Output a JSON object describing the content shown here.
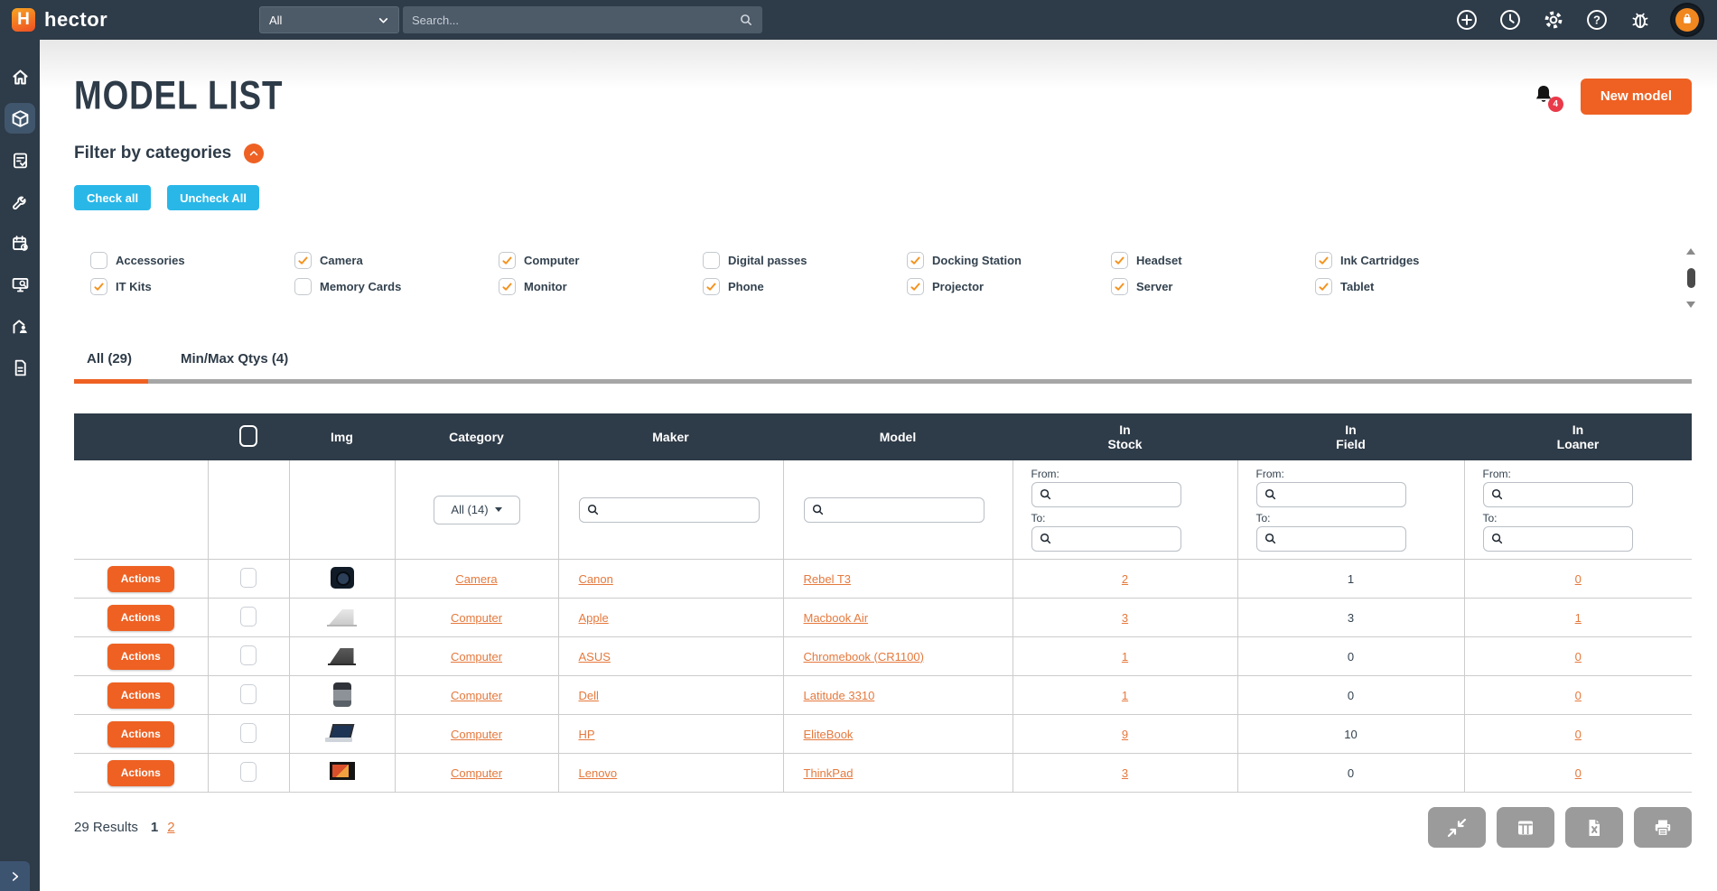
{
  "colors": {
    "dark_slate": "#2e3b48",
    "accent_orange": "#ee6123",
    "link_orange": "#e5793d",
    "check_orange": "#f5921e",
    "cyan": "#29b7e8",
    "badge_red": "#e93a4a",
    "gray_button": "#9b9b9b"
  },
  "topbar": {
    "brand": "hector",
    "scope_select_value": "All",
    "search_placeholder": "Search...",
    "icons": [
      "plus-circle-icon",
      "clock-icon",
      "gear-icon",
      "help-icon",
      "bug-icon",
      "avatar"
    ]
  },
  "sidebar": {
    "items": [
      "home-icon",
      "package-icon",
      "clipboard-check-icon",
      "wrench-icon",
      "calendar-clock-icon",
      "monitor-search-icon",
      "user-building-icon",
      "document-icon"
    ],
    "active_item": "package-icon"
  },
  "page": {
    "title": "MODEL LIST",
    "notification_count": "4",
    "new_model_label": "New model"
  },
  "filters": {
    "heading": "Filter by categories",
    "check_all_label": "Check all",
    "uncheck_all_label": "Uncheck All",
    "categories": [
      {
        "label": "Accessories",
        "checked": false
      },
      {
        "label": "Camera",
        "checked": true
      },
      {
        "label": "Computer",
        "checked": true
      },
      {
        "label": "Digital passes",
        "checked": false
      },
      {
        "label": "Docking Station",
        "checked": true
      },
      {
        "label": "Headset",
        "checked": true
      },
      {
        "label": "Ink Cartridges",
        "checked": true
      },
      {
        "label": "IT Kits",
        "checked": true
      },
      {
        "label": "Memory Cards",
        "checked": false
      },
      {
        "label": "Monitor",
        "checked": true
      },
      {
        "label": "Phone",
        "checked": true
      },
      {
        "label": "Projector",
        "checked": true
      },
      {
        "label": "Server",
        "checked": true
      },
      {
        "label": "Tablet",
        "checked": true
      }
    ]
  },
  "tabs": [
    {
      "label": "All (29)",
      "active": true
    },
    {
      "label": "Min/Max Qtys (4)",
      "active": false
    }
  ],
  "table": {
    "headers": {
      "img": "Img",
      "category": "Category",
      "maker": "Maker",
      "model": "Model",
      "in_stock": [
        "In",
        "Stock"
      ],
      "in_field": [
        "In",
        "Field"
      ],
      "in_loaner": [
        "In",
        "Loaner"
      ]
    },
    "category_filter_value": "All (14)",
    "from_label": "From:",
    "to_label": "To:",
    "actions_label": "Actions",
    "rows": [
      {
        "img": "camera",
        "category": "Camera",
        "maker": "Canon",
        "model": "Rebel T3",
        "in_stock": "2",
        "in_field": "1",
        "in_loaner": "0"
      },
      {
        "img": "macbook-air",
        "category": "Computer",
        "maker": "Apple",
        "model": "Macbook Air",
        "in_stock": "3",
        "in_field": "3",
        "in_loaner": "1"
      },
      {
        "img": "chromebook",
        "category": "Computer",
        "maker": "ASUS",
        "model": "Chromebook (CR1100)",
        "in_stock": "1",
        "in_field": "0",
        "in_loaner": "0"
      },
      {
        "img": "latitude",
        "category": "Computer",
        "maker": "Dell",
        "model": "Latitude 3310",
        "in_stock": "1",
        "in_field": "0",
        "in_loaner": "0"
      },
      {
        "img": "elitebook",
        "category": "Computer",
        "maker": "HP",
        "model": "EliteBook",
        "in_stock": "9",
        "in_field": "10",
        "in_loaner": "0"
      },
      {
        "img": "thinkpad",
        "category": "Computer",
        "maker": "Lenovo",
        "model": "ThinkPad",
        "in_stock": "3",
        "in_field": "0",
        "in_loaner": "0"
      }
    ]
  },
  "footer": {
    "results": "29 Results",
    "pages": [
      {
        "label": "1",
        "current": true
      },
      {
        "label": "2",
        "current": false
      }
    ],
    "toolbar_icons": [
      "compress-icon",
      "columns-icon",
      "excel-export-icon",
      "print-icon"
    ]
  }
}
